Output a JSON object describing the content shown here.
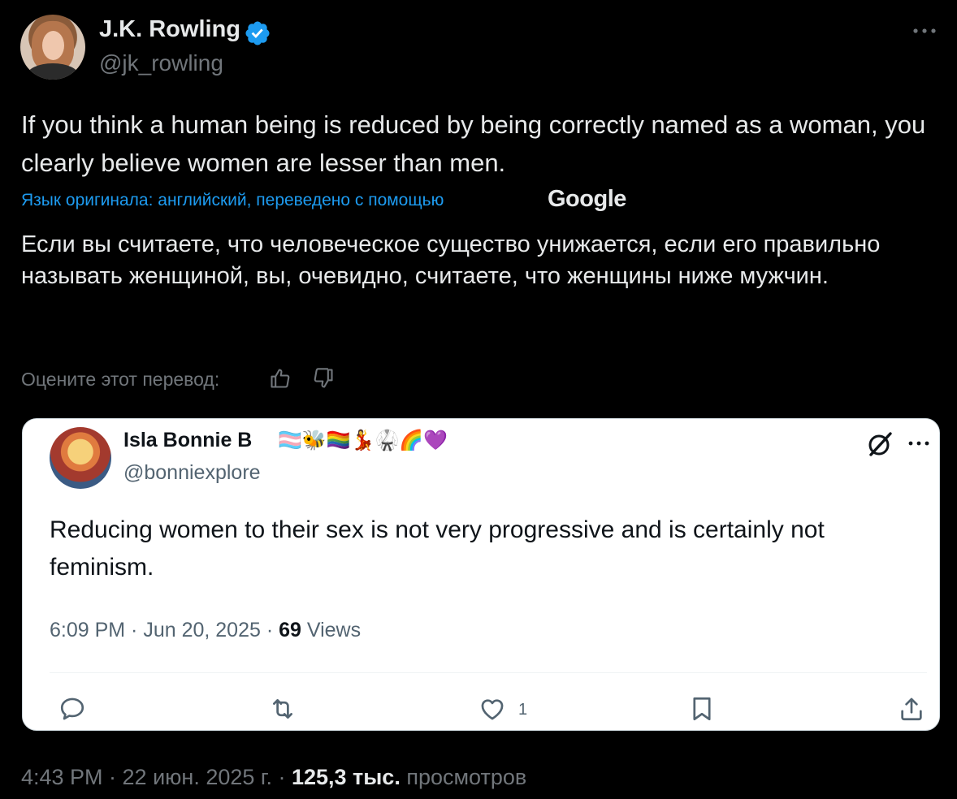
{
  "tweet": {
    "author_name": "J.K. Rowling",
    "author_handle": "@jk_rowling",
    "text": "If you think a human being is reduced by being correctly named as a woman, you clearly believe women are lesser than men.",
    "translation_label": "Язык оригинала: английский, переведено с помощью",
    "translation_provider": "Google",
    "translated_text": "Если вы считаете, что человеческое существо унижается, если его правильно называть женщиной, вы, очевидно, считаете, что женщины ниже мужчин.",
    "rate_label": "Оцените этот перевод:",
    "footer": {
      "time": "4:43 PM · 22 июн. 2025 г. · ",
      "views_count": "125,3 тыс.",
      "views_label": " просмотров"
    }
  },
  "quote": {
    "author_name": "Isla Bonnie B",
    "author_emojis": "🏳️‍⚧️🐝🏳️‍🌈💃🥋🌈💜",
    "author_handle": "@bonniexplore",
    "text": "Reducing women to their sex is not very progressive and is certainly not feminism.",
    "meta_time": "6:09 PM · Jun 20, 2025 · ",
    "views_count": "69",
    "views_label": " Views",
    "like_count": "1"
  },
  "icons": {
    "verified": "verified-badge-icon",
    "more": "more-icon",
    "thumb_up": "thumbs-up-icon",
    "thumb_down": "thumbs-down-icon",
    "grok": "grok-icon",
    "reply": "reply-icon",
    "retweet": "retweet-icon",
    "like": "like-icon",
    "bookmark": "bookmark-icon",
    "share": "share-icon"
  },
  "colors": {
    "background": "#000000",
    "text": "#e7e9ea",
    "muted": "#71767b",
    "link": "#1d9bf0",
    "card": "#ffffff"
  }
}
